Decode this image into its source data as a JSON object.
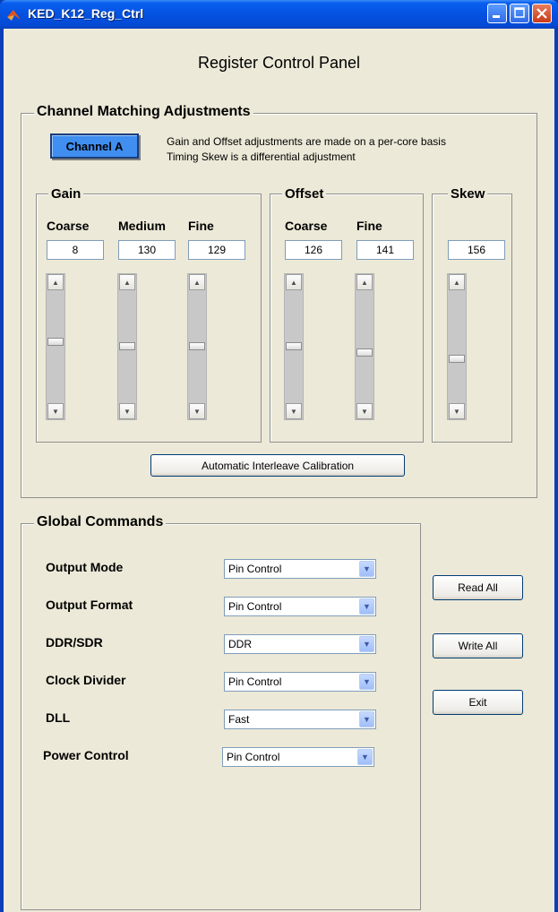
{
  "window": {
    "title": "KED_K12_Reg_Ctrl"
  },
  "panel_title": "Register Control Panel",
  "channel_matching": {
    "label": "Channel Matching Adjustments",
    "channel_button": "Channel A",
    "note_line1": "Gain and Offset adjustments are made on a per-core basis",
    "note_line2": "Timing Skew is a differential adjustment",
    "gain": {
      "label": "Gain",
      "coarse": {
        "label": "Coarse",
        "value": "8",
        "slider_level": 0.45
      },
      "medium": {
        "label": "Medium",
        "value": "130",
        "slider_level": 0.49
      },
      "fine": {
        "label": "Fine",
        "value": "129",
        "slider_level": 0.49
      }
    },
    "offset": {
      "label": "Offset",
      "coarse": {
        "label": "Coarse",
        "value": "126",
        "slider_level": 0.49
      },
      "fine": {
        "label": "Fine",
        "value": "141",
        "slider_level": 0.55
      }
    },
    "skew": {
      "label": "Skew",
      "value": "156",
      "slider_level": 0.61
    },
    "calibration_button": "Automatic Interleave Calibration"
  },
  "global_commands": {
    "label": "Global Commands",
    "rows": [
      {
        "label": "Output Mode",
        "value": "Pin Control"
      },
      {
        "label": "Output Format",
        "value": "Pin Control"
      },
      {
        "label": "DDR/SDR",
        "value": "DDR"
      },
      {
        "label": "Clock Divider",
        "value": "Pin Control"
      },
      {
        "label": "DLL",
        "value": "Fast"
      },
      {
        "label": "Power Control",
        "value": "Pin Control"
      }
    ]
  },
  "actions": {
    "read_all": "Read All",
    "write_all": "Write All",
    "exit": "Exit"
  }
}
